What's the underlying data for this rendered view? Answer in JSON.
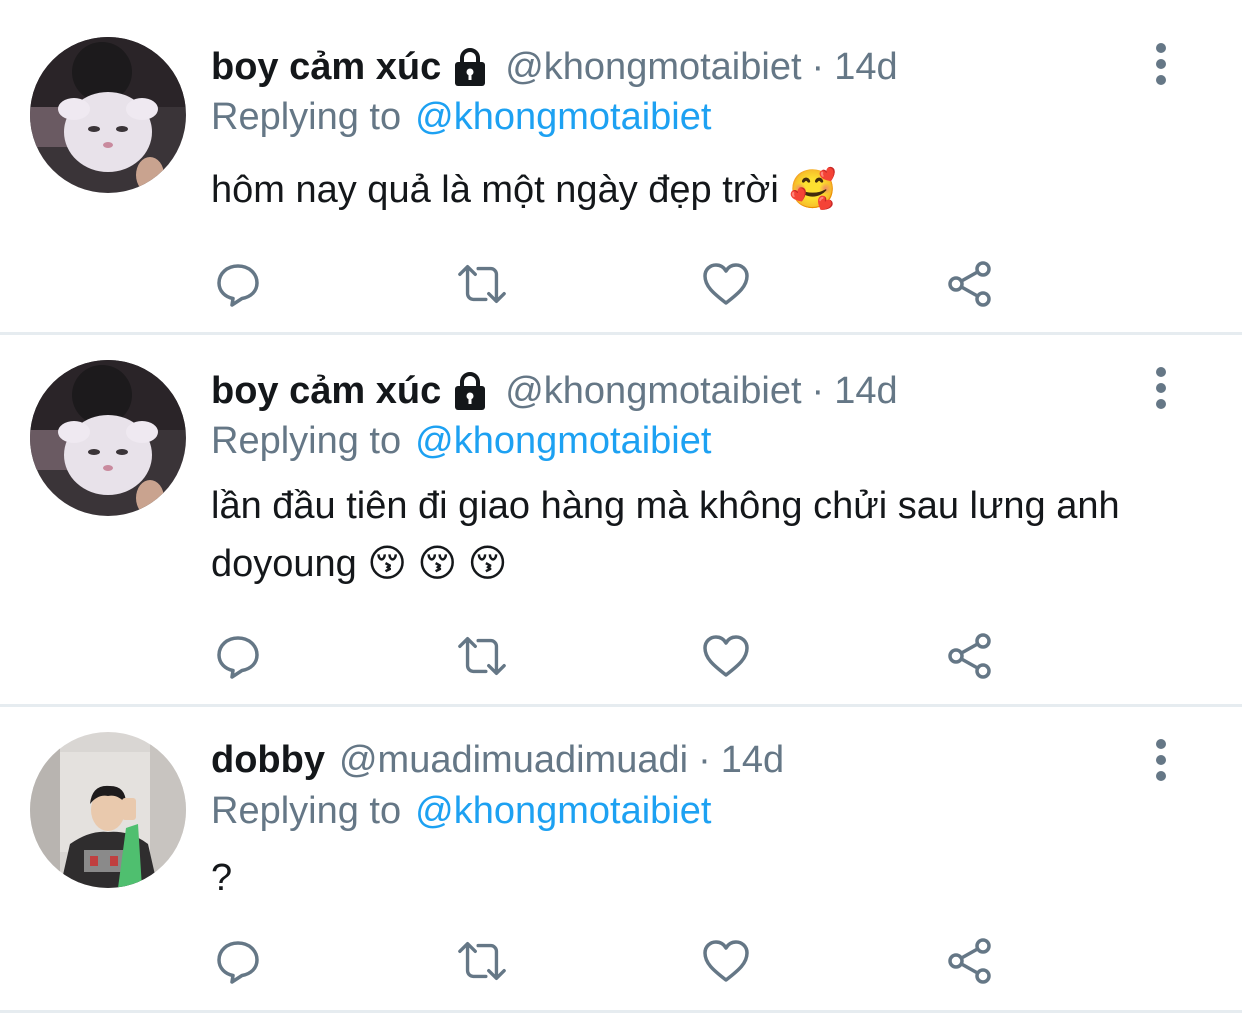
{
  "tweets": [
    {
      "display_name": "boy cảm xúc",
      "protected": true,
      "handle": "@khongmotaibiet",
      "separator": "·",
      "time": "14d",
      "replying_prefix": "Replying to",
      "replying_to": "@khongmotaibiet",
      "text": "hôm nay quả là một ngày đẹp trời 🥰",
      "avatar_icon": "avatar-plush-doll"
    },
    {
      "display_name": "boy cảm xúc",
      "protected": true,
      "handle": "@khongmotaibiet",
      "separator": "·",
      "time": "14d",
      "replying_prefix": "Replying to",
      "replying_to": "@khongmotaibiet",
      "text": "lần đầu tiên đi giao hàng mà không chửi sau lưng anh doyoung 😚 😚 😚",
      "avatar_icon": "avatar-plush-doll"
    },
    {
      "display_name": "dobby",
      "protected": false,
      "handle": "@muadimuadimuadi",
      "separator": "·",
      "time": "14d",
      "replying_prefix": "Replying to",
      "replying_to": "@khongmotaibiet",
      "text": "?",
      "avatar_icon": "avatar-mirror-selfie"
    }
  ],
  "actions": [
    "reply-icon",
    "retweet-icon",
    "like-icon",
    "share-icon"
  ],
  "colors": {
    "text": "#14171a",
    "muted": "#657786",
    "link": "#1da1f2",
    "icon": "#657786",
    "divider": "#e6ecf0"
  }
}
